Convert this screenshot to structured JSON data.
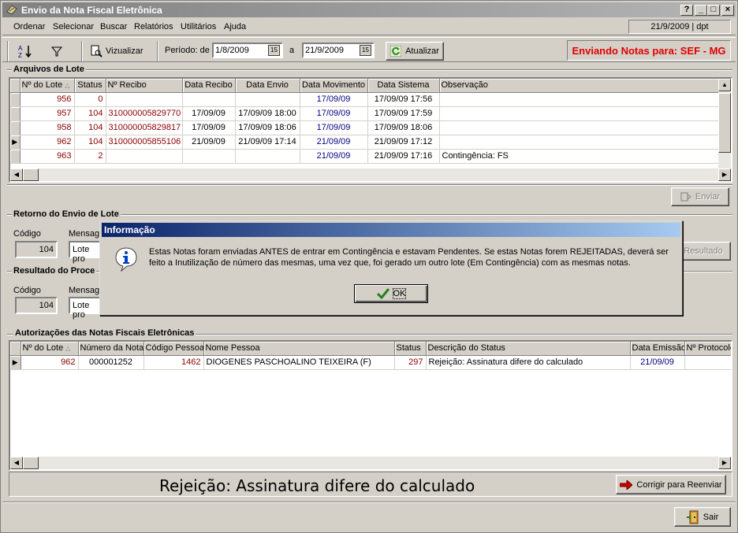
{
  "window": {
    "title": "Envio da Nota Fiscal Eletrônica",
    "controls": {
      "help": "?",
      "minimize": "_",
      "maximize": "□",
      "close": "×"
    }
  },
  "menu": {
    "items": [
      "Ordenar",
      "Selecionar",
      "Buscar",
      "Relatórios",
      "Utilitários",
      "Ajuda"
    ],
    "date_user": "21/9/2009 | dpt"
  },
  "toolbar": {
    "sort_icon": "A↓Z",
    "filter_icon": "filter-icon",
    "visualizar_label": "Vizualizar",
    "periodo_label": "Período: de",
    "date_from": "1/8/2009",
    "to_label": "a",
    "date_to": "21/9/2009",
    "calendar_glyph": "15",
    "atualizar_label": "Atualizar",
    "sending_status": "Enviando Notas para: SEF - MG"
  },
  "lotes": {
    "title": "Arquivos de Lote",
    "columns": [
      "Nº do Lote",
      "Status",
      "Nº Recibo",
      "Data Recibo",
      "Data Envio",
      "Data Movimento",
      "Data Sistema",
      "Observação"
    ],
    "rows": [
      [
        "956",
        "0",
        "",
        "",
        "",
        "17/09/09",
        "17/09/09 17:56",
        ""
      ],
      [
        "957",
        "104",
        "310000005829770",
        "17/09/09",
        "17/09/09 18:00",
        "17/09/09",
        "17/09/09 17:59",
        ""
      ],
      [
        "958",
        "104",
        "310000005829817",
        "17/09/09",
        "17/09/09 18:06",
        "17/09/09",
        "17/09/09 18:06",
        ""
      ],
      [
        "962",
        "104",
        "310000005855106",
        "21/09/09",
        "21/09/09 17:14",
        "21/09/09",
        "21/09/09 17:12",
        ""
      ],
      [
        "963",
        "2",
        "",
        "",
        "",
        "21/09/09",
        "21/09/09 17:16",
        "Contingência: FS"
      ]
    ],
    "enviar_label": "Enviar"
  },
  "retorno": {
    "title": "Retorno do Envio de Lote",
    "codigo_label": "Código",
    "codigo_value": "104",
    "mensagem_label": "Mensage",
    "mensagem_value": "Lote pro",
    "resultado_label": "Resultado"
  },
  "resultado": {
    "title": "Resultado do Proce",
    "codigo_label": "Código",
    "codigo_value": "104",
    "mensagem_label": "Mensage",
    "mensagem_value": "Lote pro"
  },
  "dialog": {
    "title": "Informação",
    "message": "Estas Notas foram enviadas ANTES de entrar em Contingência e estavam Pendentes. Se estas Notas forem REJEITADAS, deverá ser feito a Inutilização de número das mesmas, uma vez que, foi gerado um outro lote (Em Contingência) com as mesmas notas.",
    "ok_label": "OK"
  },
  "autorizacoes": {
    "title": "Autorizações das Notas Fiscais Eletrônicas",
    "columns": [
      "Nº do Lote",
      "Número da Nota",
      "Código Pessoa",
      "Nome Pessoa",
      "Status",
      "Descrição do Status",
      "Data Emissão",
      "Nº Protocolo"
    ],
    "rows": [
      [
        "962",
        "000001252",
        "1462",
        "DIOGENES PASCHOALINO TEIXEIRA (F)",
        "297",
        "Rejeição: Assinatura difere do calculado",
        "21/09/09",
        ""
      ]
    ]
  },
  "footer": {
    "status_message": "Rejeição: Assinatura difere do calculado",
    "corrigir_label": "Corrigir para Reenviar",
    "sair_label": "Sair"
  }
}
